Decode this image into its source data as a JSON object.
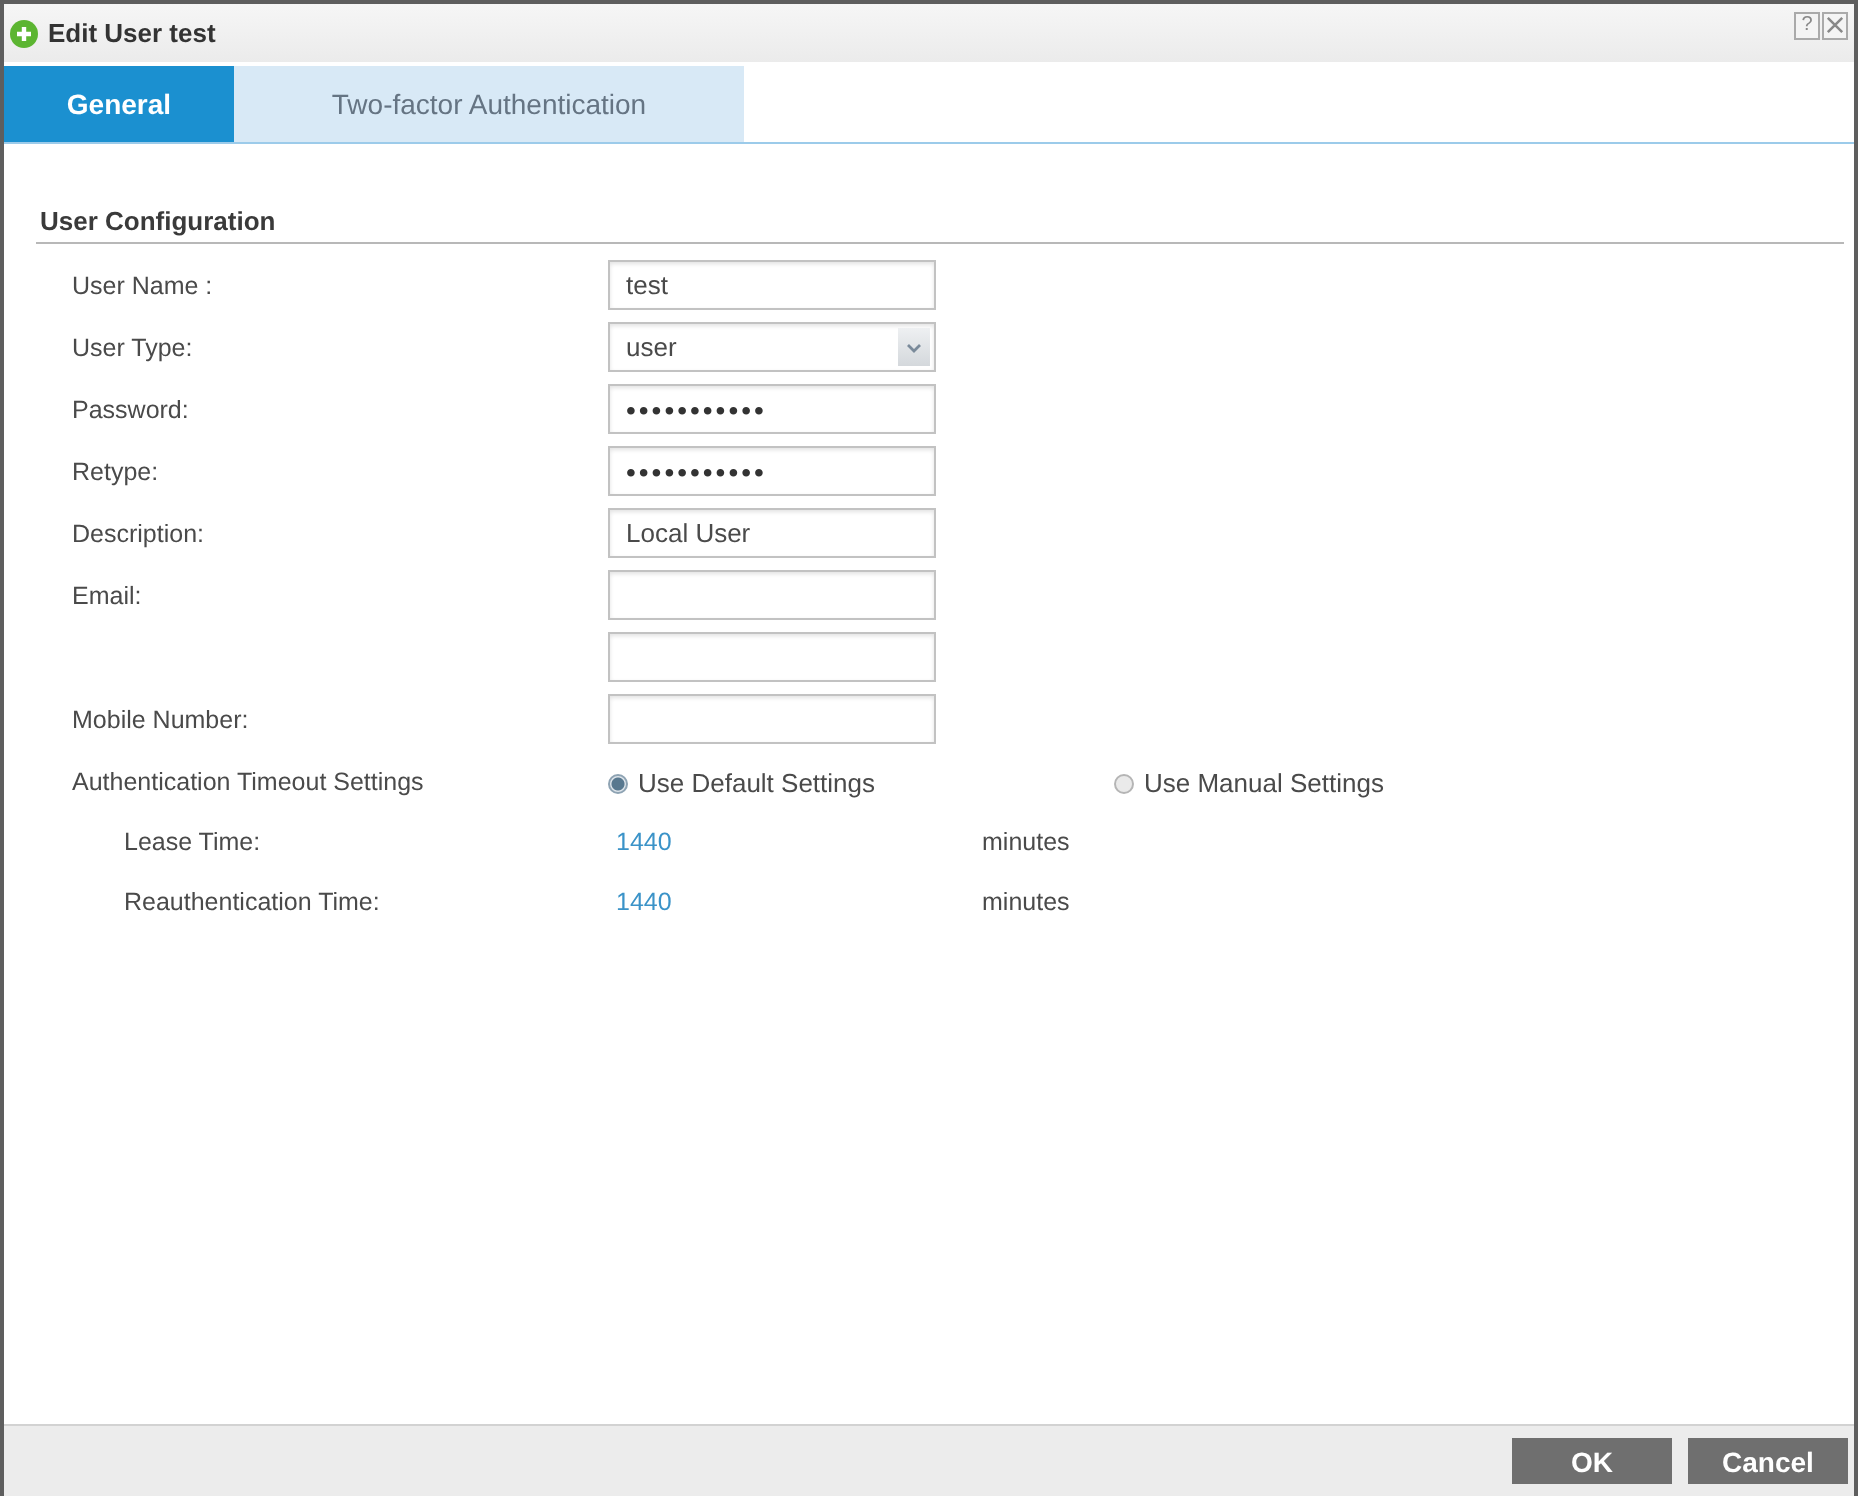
{
  "window": {
    "title": "Edit User test",
    "help": "?"
  },
  "tabs": [
    {
      "label": "General",
      "selected": true
    },
    {
      "label": "Two-factor Authentication",
      "selected": false
    }
  ],
  "section": {
    "title": "User Configuration"
  },
  "fields": [
    {
      "kind": "text",
      "label": "User Name :",
      "value": "test"
    },
    {
      "kind": "select",
      "label": "User Type:",
      "value": "user"
    },
    {
      "kind": "password",
      "label": "Password:",
      "value": "•••••••••••"
    },
    {
      "kind": "password",
      "label": "Retype:",
      "value": "•••••••••••"
    },
    {
      "kind": "text",
      "label": "Description:",
      "value": "Local User"
    },
    {
      "kind": "text",
      "label": "Email:"
    },
    {
      "kind": "text"
    },
    {
      "kind": "text",
      "label": "Mobile Number:"
    }
  ],
  "timeout": {
    "label": "Authentication Timeout Settings",
    "options": [
      {
        "label": "Use Default Settings",
        "selected": true
      },
      {
        "label": "Use Manual Settings",
        "selected": false
      }
    ],
    "rows": [
      {
        "label": "Lease Time:",
        "value": "1440",
        "unit": "minutes"
      },
      {
        "label": "Reauthentication Time:",
        "value": "1440",
        "unit": "minutes"
      }
    ]
  },
  "buttons": [
    {
      "label": "OK"
    },
    {
      "label": "Cancel"
    }
  ]
}
